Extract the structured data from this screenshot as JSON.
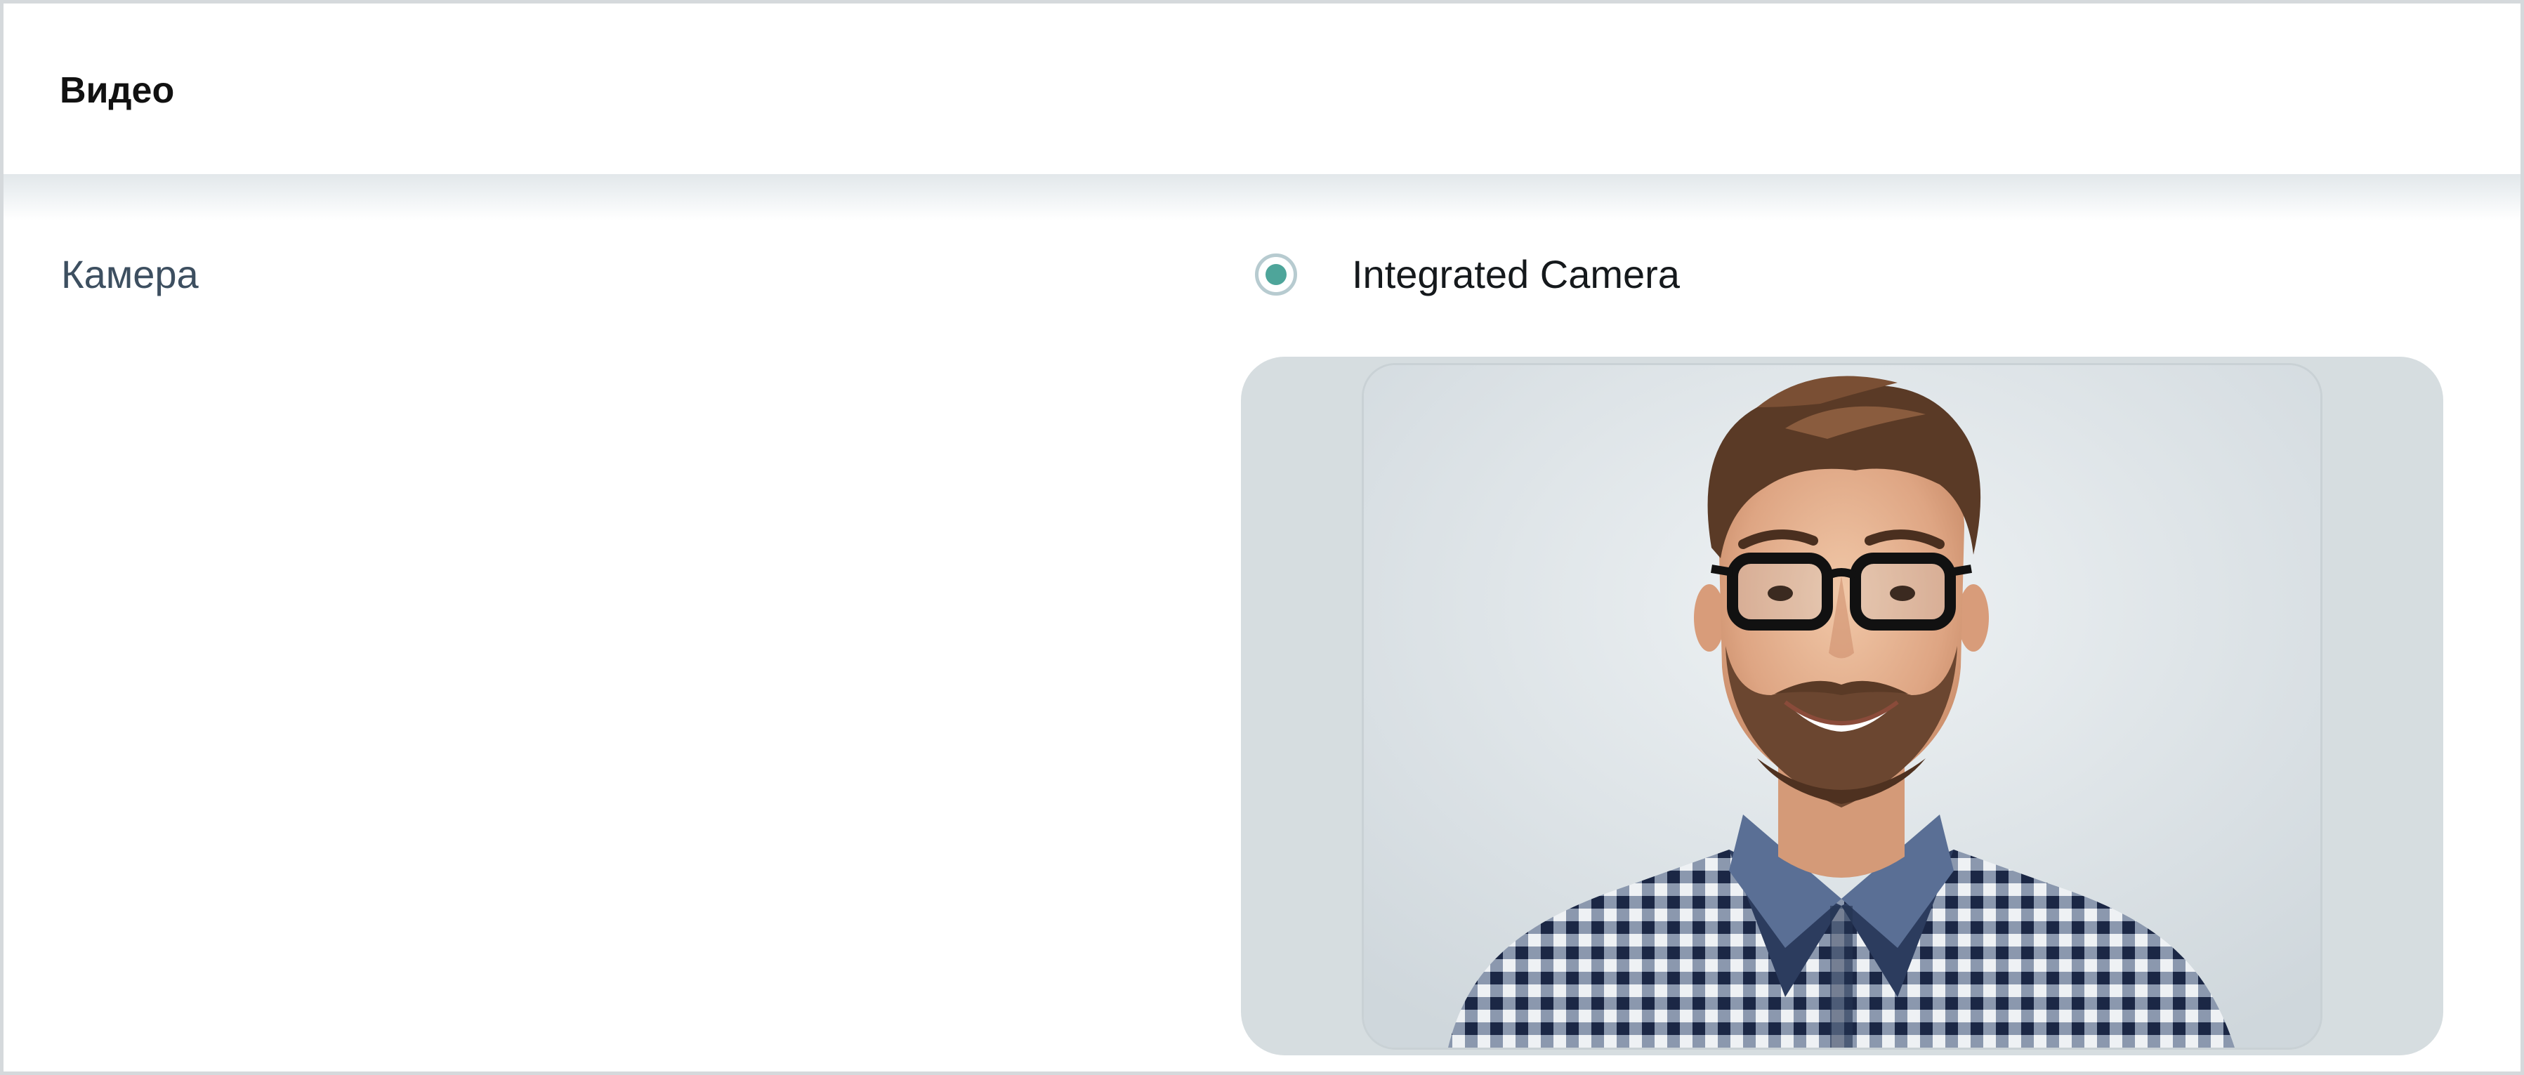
{
  "header": {
    "title": "Видео"
  },
  "camera": {
    "label": "Камера",
    "options": [
      {
        "label": "Integrated Camera",
        "selected": true
      }
    ],
    "preview_alt": "camera-preview"
  },
  "colors": {
    "accent": "#4ea59a",
    "radio_border": "#b7cbd0",
    "label_text": "#3d4f60",
    "preview_bg": "#d6dde0"
  }
}
